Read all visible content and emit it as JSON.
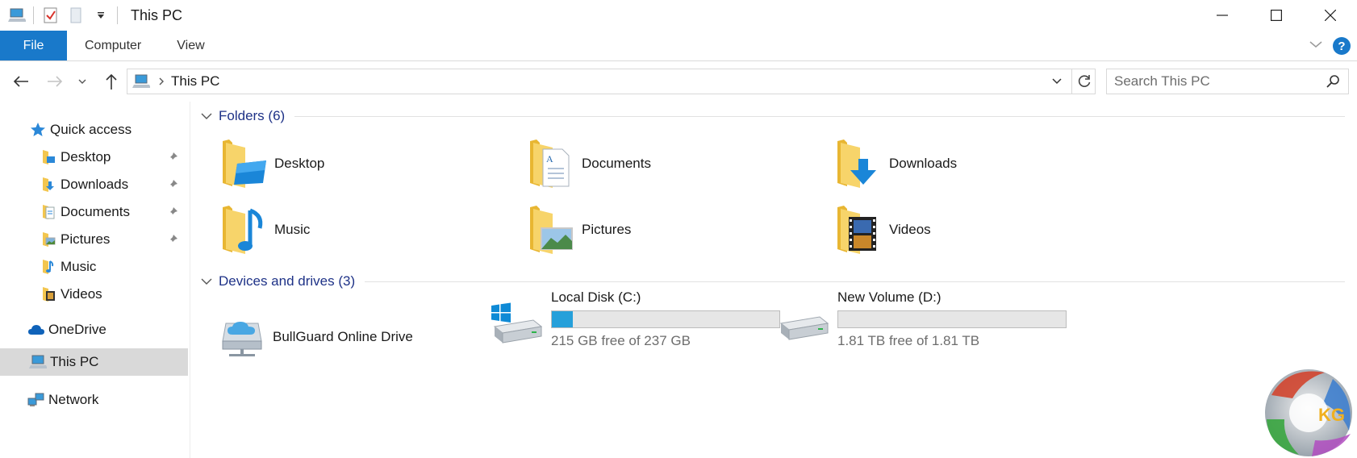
{
  "window": {
    "title": "This PC",
    "colors": {
      "accent": "#1979ca",
      "group_header": "#1e3287",
      "drive_fill": "#26a0da"
    }
  },
  "quick_access_toolbar": {
    "icons": [
      "computer-icon",
      "properties-checkmark-icon",
      "new-folder-icon",
      "customize-dropdown-icon"
    ]
  },
  "ribbon": {
    "tabs": [
      {
        "label": "File"
      },
      {
        "label": "Computer"
      },
      {
        "label": "View"
      }
    ]
  },
  "address": {
    "path": "This PC",
    "search_placeholder": "Search This PC"
  },
  "nav": {
    "quick_access": "Quick access",
    "items": [
      {
        "label": "Desktop",
        "pinned": true
      },
      {
        "label": "Downloads",
        "pinned": true
      },
      {
        "label": "Documents",
        "pinned": true
      },
      {
        "label": "Pictures",
        "pinned": true
      },
      {
        "label": "Music",
        "pinned": false
      },
      {
        "label": "Videos",
        "pinned": false
      }
    ],
    "onedrive": "OneDrive",
    "this_pc": "This PC",
    "network": "Network"
  },
  "folders": {
    "header": "Folders (6)",
    "items": [
      {
        "label": "Desktop"
      },
      {
        "label": "Documents"
      },
      {
        "label": "Downloads"
      },
      {
        "label": "Music"
      },
      {
        "label": "Pictures"
      },
      {
        "label": "Videos"
      }
    ]
  },
  "devices": {
    "header": "Devices and drives (3)",
    "items": [
      {
        "label": "BullGuard Online Drive"
      },
      {
        "label": "Local Disk (C:)",
        "free_text": "215 GB free of 237 GB",
        "used_fraction": 0.093
      },
      {
        "label": "New Volume (D:)",
        "free_text": "1.81 TB free of 1.81 TB",
        "used_fraction": 0.0
      }
    ]
  },
  "watermark": {
    "text": "KG"
  }
}
